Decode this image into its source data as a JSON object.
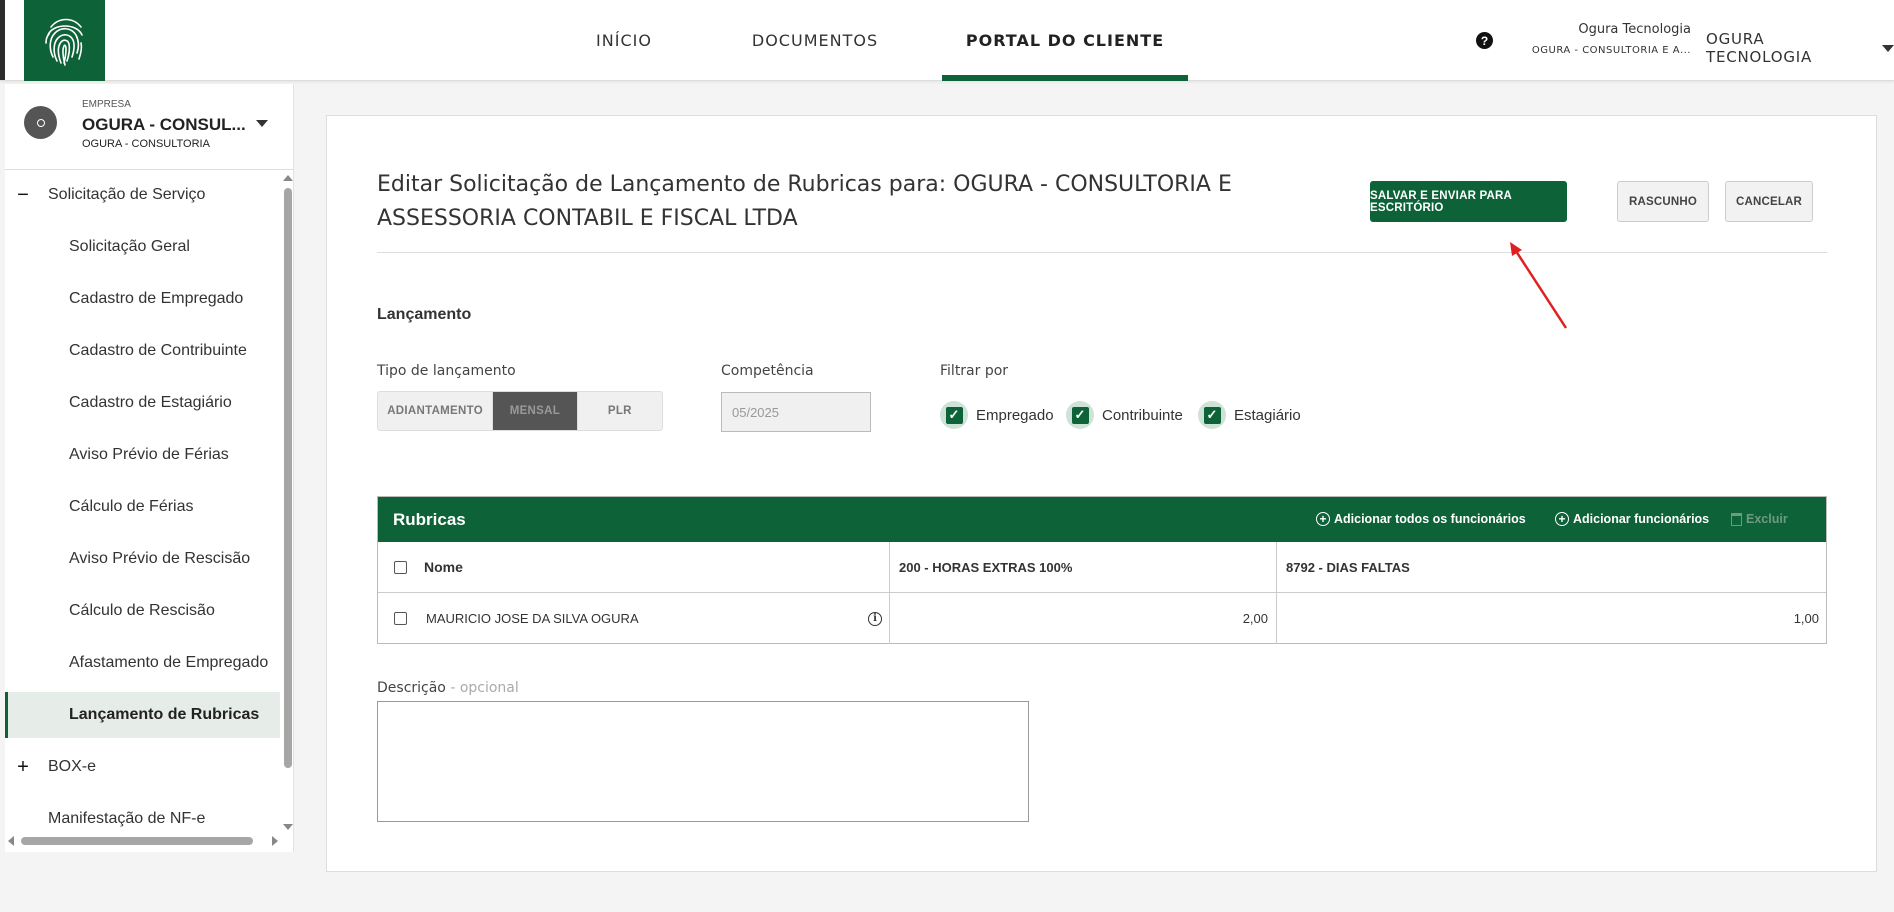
{
  "nav": {
    "items": [
      {
        "label": "INÍCIO"
      },
      {
        "label": "DOCUMENTOS"
      },
      {
        "label": "PORTAL DO CLIENTE"
      }
    ],
    "active_index": 2,
    "accent_color": "#0d6238"
  },
  "user": {
    "name": "Ogura Tecnologia",
    "company": "OGURA - CONSULTORIA E A...",
    "account_label": "OGURA TECNOLOGIA"
  },
  "company": {
    "label": "EMPRESA",
    "name": "OGURA - CONSUL...",
    "sub": "OGURA - CONSULTORIA"
  },
  "sidebar": {
    "items": [
      {
        "label": "Solicitação de Serviço",
        "kind": "group-open"
      },
      {
        "label": "Solicitação Geral",
        "kind": "sub"
      },
      {
        "label": "Cadastro de Empregado",
        "kind": "sub"
      },
      {
        "label": "Cadastro de Contribuinte",
        "kind": "sub"
      },
      {
        "label": "Cadastro de Estagiário",
        "kind": "sub"
      },
      {
        "label": "Aviso Prévio de Férias",
        "kind": "sub"
      },
      {
        "label": "Cálculo de Férias",
        "kind": "sub"
      },
      {
        "label": "Aviso Prévio de Rescisão",
        "kind": "sub"
      },
      {
        "label": "Cálculo de Rescisão",
        "kind": "sub"
      },
      {
        "label": "Afastamento de Empregado",
        "kind": "sub"
      },
      {
        "label": "Lançamento de Rubricas",
        "kind": "sub-active"
      },
      {
        "label": "BOX-e",
        "kind": "group-closed"
      },
      {
        "label": "Manifestação de NF-e",
        "kind": "group"
      }
    ]
  },
  "page": {
    "title": "Editar Solicitação de Lançamento de Rubricas para: OGURA - CONSULTORIA E ASSESSORIA CONTABIL E FISCAL LTDA",
    "buttons": {
      "save": "SALVAR E ENVIAR PARA ESCRITÓRIO",
      "draft": "RASCUNHO",
      "cancel": "CANCELAR"
    }
  },
  "form": {
    "section_title": "Lançamento",
    "tipo_label": "Tipo de lançamento",
    "tipo_options": [
      "ADIANTAMENTO",
      "MENSAL",
      "PLR"
    ],
    "tipo_selected": "MENSAL",
    "competencia_label": "Competência",
    "competencia_value": "05/2025",
    "filtrar_label": "Filtrar por",
    "filters": [
      {
        "label": "Empregado",
        "checked": true
      },
      {
        "label": "Contribuinte",
        "checked": true
      },
      {
        "label": "Estagiário",
        "checked": true
      }
    ]
  },
  "rubricas": {
    "title": "Rubricas",
    "actions": {
      "add_all": "Adicionar todos os funcionários",
      "add": "Adicionar funcionários",
      "delete": "Excluir"
    },
    "columns": [
      "Nome",
      "200 - HORAS EXTRAS 100%",
      "8792 - DIAS FALTAS"
    ],
    "rows": [
      {
        "name": "MAURICIO JOSE DA SILVA OGURA",
        "values": [
          "2,00",
          "1,00"
        ]
      }
    ]
  },
  "descricao": {
    "label": "Descrição",
    "optional": "- opcional"
  }
}
